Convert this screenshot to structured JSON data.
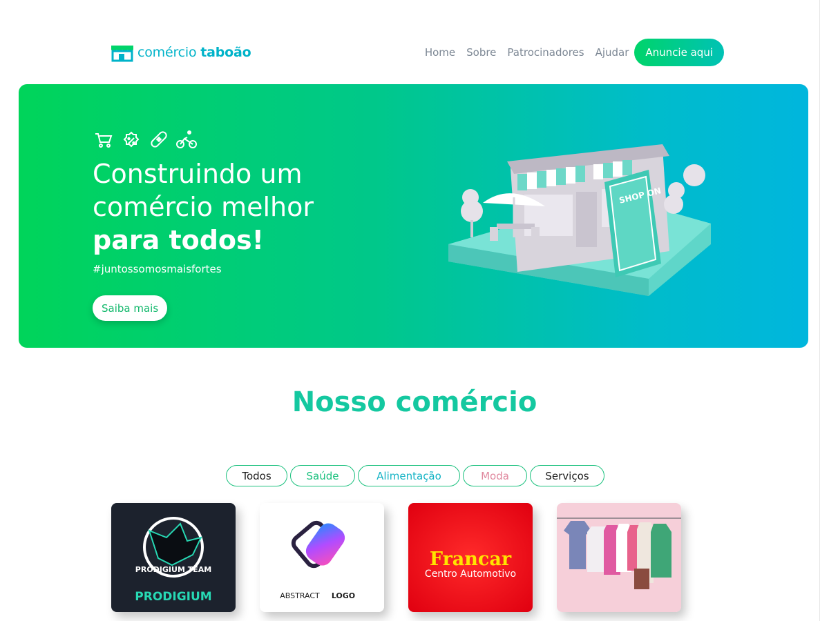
{
  "brand": {
    "name_light": "comércio",
    "name_bold": "taboão"
  },
  "nav": {
    "items": [
      "Home",
      "Sobre",
      "Patrocinadores",
      "Ajudar"
    ],
    "cta": "Anuncie aqui"
  },
  "hero": {
    "icons": [
      "cart-icon",
      "discount-badge-icon",
      "bandage-icon",
      "bicycle-icon"
    ],
    "title_line1": "Construindo um",
    "title_line2": "comércio melhor",
    "title_line3": "para todos!",
    "hashtag": "#juntossomosmaisfortes",
    "button": "Saiba mais",
    "sign_text": "SHOP ON"
  },
  "section": {
    "title": "Nosso comércio"
  },
  "filters": [
    "Todos",
    "Saúde",
    "Alimentação",
    "Moda",
    "Serviços"
  ],
  "cards": [
    {
      "name": "prodigium-card",
      "logo_text": "PRODIGIUM",
      "subtitle": "PRODIGIUM TEAM"
    },
    {
      "name": "abstract-logo-card",
      "logo_text_light": "ABSTRACT",
      "logo_text_bold": "LOGO"
    },
    {
      "name": "francar-card",
      "logo_text": "Francar",
      "subtitle": "Centro Automotivo"
    },
    {
      "name": "clothing-card"
    }
  ],
  "colors": {
    "accent_green": "#00d45a",
    "accent_cyan": "#00b6dd",
    "title_teal": "#14c8a0",
    "francar_red": "#ff1a1a"
  }
}
